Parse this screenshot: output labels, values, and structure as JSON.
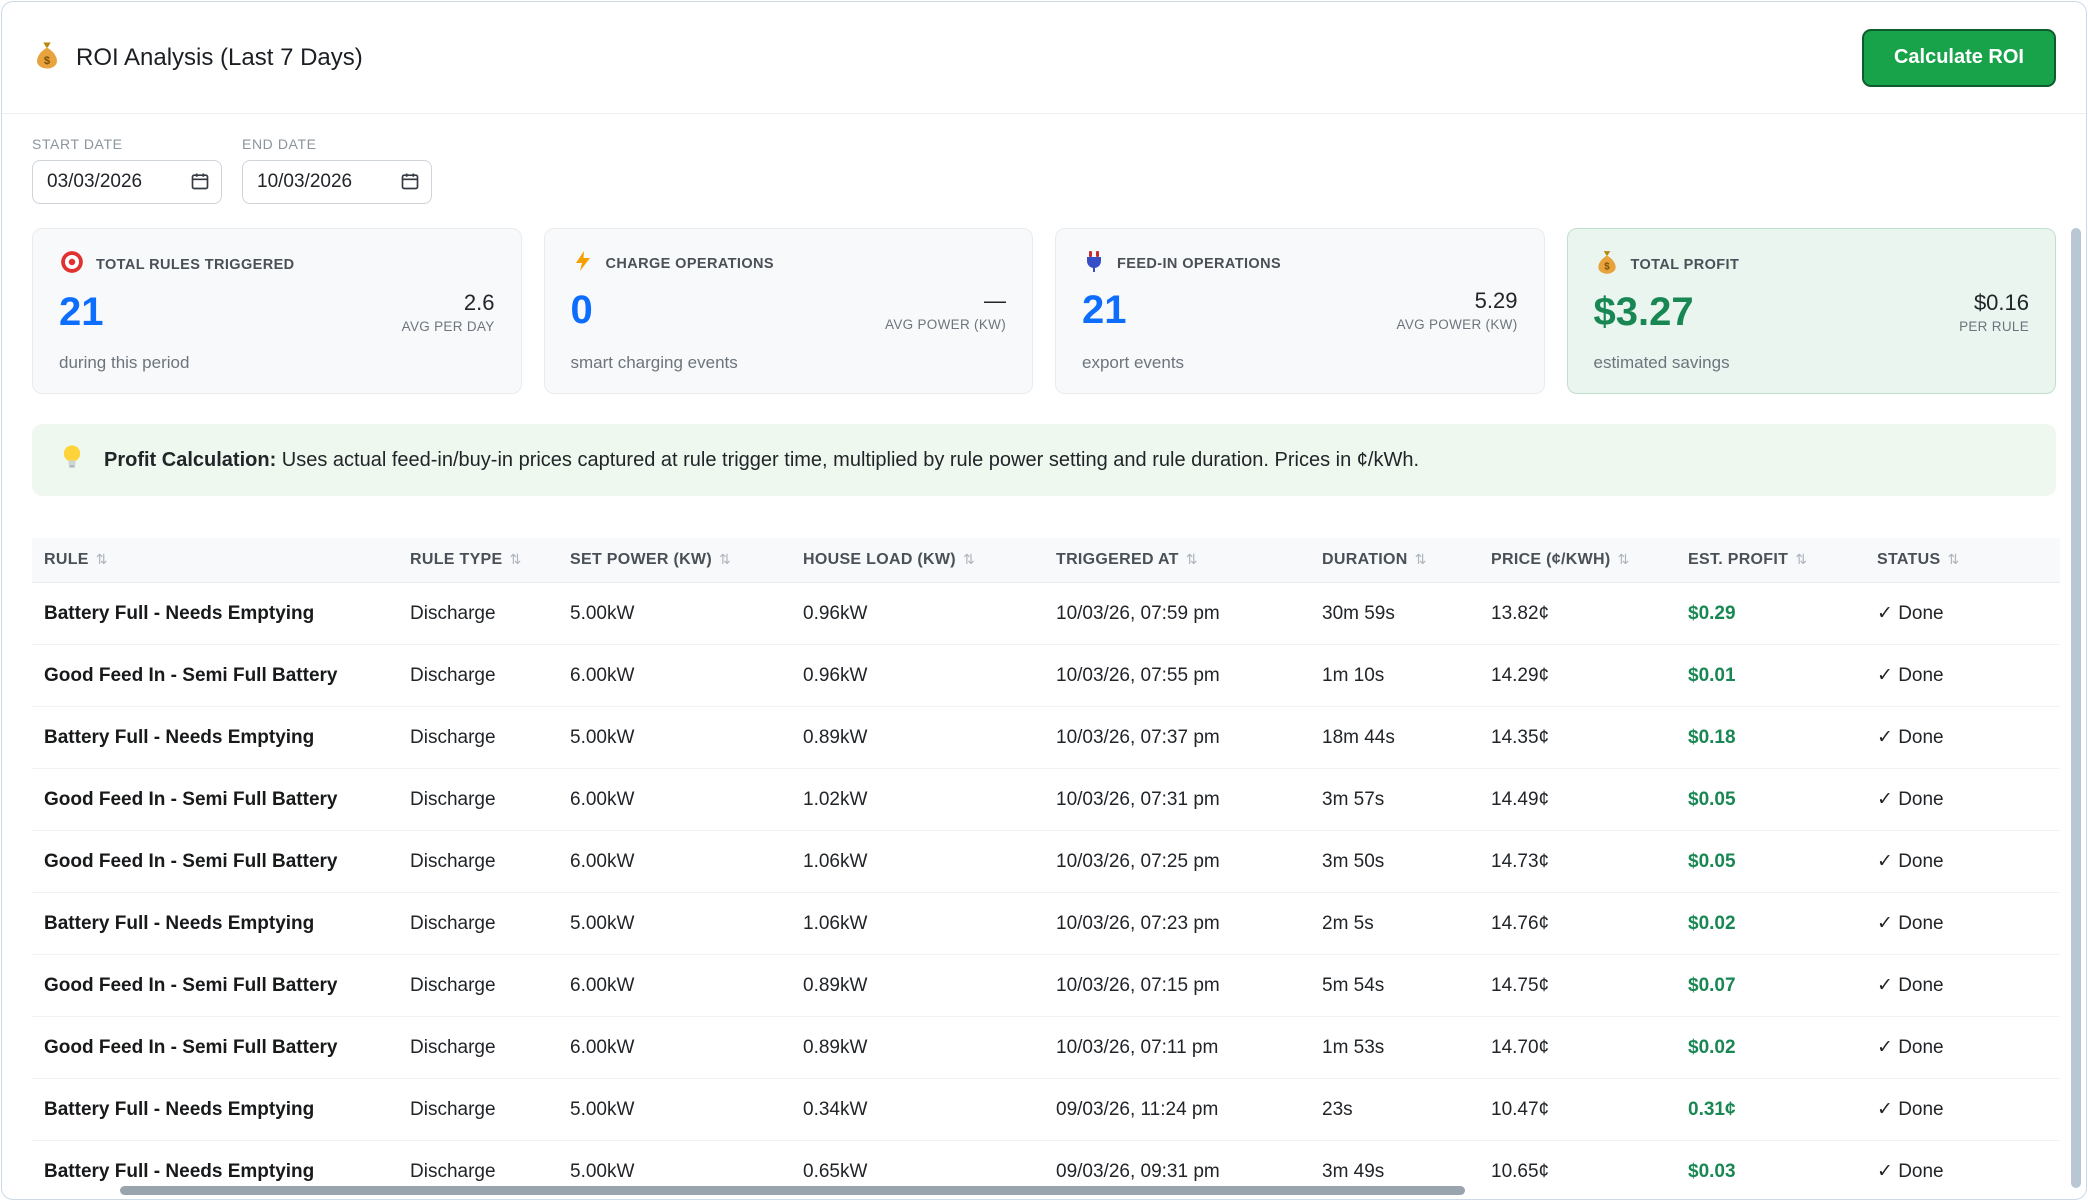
{
  "header": {
    "icon": "moneybag-icon",
    "title": "ROI Analysis (Last 7 Days)",
    "calculate_button_label": "Calculate ROI"
  },
  "filters": {
    "start_date_label": "START DATE",
    "start_date_value": "03/03/2026",
    "end_date_label": "END DATE",
    "end_date_value": "10/03/2026"
  },
  "stat_cards": [
    {
      "icon": "target-icon",
      "title": "TOTAL RULES TRIGGERED",
      "value": "21",
      "side_value": "2.6",
      "side_label": "AVG PER DAY",
      "footer": "during this period"
    },
    {
      "icon": "lightning-icon",
      "title": "CHARGE OPERATIONS",
      "value": "0",
      "side_value": "—",
      "side_label": "AVG POWER (KW)",
      "footer": "smart charging events"
    },
    {
      "icon": "plug-icon",
      "title": "FEED-IN OPERATIONS",
      "value": "21",
      "side_value": "5.29",
      "side_label": "AVG POWER (KW)",
      "footer": "export events"
    },
    {
      "icon": "moneybag-icon",
      "title": "TOTAL PROFIT",
      "value": "$3.27",
      "side_value": "$0.16",
      "side_label": "PER RULE",
      "footer": "estimated savings"
    }
  ],
  "info_banner": {
    "icon": "bulb-icon",
    "title": "Profit Calculation:",
    "text": "Uses actual feed-in/buy-in prices captured at rule trigger time, multiplied by rule power setting and rule duration. Prices in ¢/kWh."
  },
  "table": {
    "sort_glyph": "⇅",
    "columns": [
      {
        "key": "rule",
        "label": "RULE"
      },
      {
        "key": "rule_type",
        "label": "RULE TYPE"
      },
      {
        "key": "set_power",
        "label": "SET POWER (KW)"
      },
      {
        "key": "house_load",
        "label": "HOUSE LOAD (KW)"
      },
      {
        "key": "triggered_at",
        "label": "TRIGGERED AT"
      },
      {
        "key": "duration",
        "label": "DURATION"
      },
      {
        "key": "price",
        "label": "PRICE (¢/KWH)"
      },
      {
        "key": "est_profit",
        "label": "EST. PROFIT"
      },
      {
        "key": "status",
        "label": "STATUS"
      }
    ],
    "rows": [
      {
        "rule": "Battery Full - Needs Emptying",
        "rule_type": "Discharge",
        "set_power": "5.00kW",
        "house_load": "0.96kW",
        "triggered_at": "10/03/26, 07:59 pm",
        "duration": "30m 59s",
        "price": "13.82¢",
        "est_profit": "$0.29",
        "status": "✓ Done"
      },
      {
        "rule": "Good Feed In - Semi Full Battery",
        "rule_type": "Discharge",
        "set_power": "6.00kW",
        "house_load": "0.96kW",
        "triggered_at": "10/03/26, 07:55 pm",
        "duration": "1m 10s",
        "price": "14.29¢",
        "est_profit": "$0.01",
        "status": "✓ Done"
      },
      {
        "rule": "Battery Full - Needs Emptying",
        "rule_type": "Discharge",
        "set_power": "5.00kW",
        "house_load": "0.89kW",
        "triggered_at": "10/03/26, 07:37 pm",
        "duration": "18m 44s",
        "price": "14.35¢",
        "est_profit": "$0.18",
        "status": "✓ Done"
      },
      {
        "rule": "Good Feed In - Semi Full Battery",
        "rule_type": "Discharge",
        "set_power": "6.00kW",
        "house_load": "1.02kW",
        "triggered_at": "10/03/26, 07:31 pm",
        "duration": "3m 57s",
        "price": "14.49¢",
        "est_profit": "$0.05",
        "status": "✓ Done"
      },
      {
        "rule": "Good Feed In - Semi Full Battery",
        "rule_type": "Discharge",
        "set_power": "6.00kW",
        "house_load": "1.06kW",
        "triggered_at": "10/03/26, 07:25 pm",
        "duration": "3m 50s",
        "price": "14.73¢",
        "est_profit": "$0.05",
        "status": "✓ Done"
      },
      {
        "rule": "Battery Full - Needs Emptying",
        "rule_type": "Discharge",
        "set_power": "5.00kW",
        "house_load": "1.06kW",
        "triggered_at": "10/03/26, 07:23 pm",
        "duration": "2m 5s",
        "price": "14.76¢",
        "est_profit": "$0.02",
        "status": "✓ Done"
      },
      {
        "rule": "Good Feed In - Semi Full Battery",
        "rule_type": "Discharge",
        "set_power": "6.00kW",
        "house_load": "0.89kW",
        "triggered_at": "10/03/26, 07:15 pm",
        "duration": "5m 54s",
        "price": "14.75¢",
        "est_profit": "$0.07",
        "status": "✓ Done"
      },
      {
        "rule": "Good Feed In - Semi Full Battery",
        "rule_type": "Discharge",
        "set_power": "6.00kW",
        "house_load": "0.89kW",
        "triggered_at": "10/03/26, 07:11 pm",
        "duration": "1m 53s",
        "price": "14.70¢",
        "est_profit": "$0.02",
        "status": "✓ Done"
      },
      {
        "rule": "Battery Full - Needs Emptying",
        "rule_type": "Discharge",
        "set_power": "5.00kW",
        "house_load": "0.34kW",
        "triggered_at": "09/03/26, 11:24 pm",
        "duration": "23s",
        "price": "10.47¢",
        "est_profit": "0.31¢",
        "status": "✓ Done"
      },
      {
        "rule": "Battery Full - Needs Emptying",
        "rule_type": "Discharge",
        "set_power": "5.00kW",
        "house_load": "0.65kW",
        "triggered_at": "09/03/26, 09:31 pm",
        "duration": "3m 49s",
        "price": "10.65¢",
        "est_profit": "$0.03",
        "status": "✓ Done"
      }
    ]
  },
  "colors": {
    "accent_blue": "#0d6efd",
    "success_green": "#198754",
    "button_green": "#18a34a",
    "card_bg": "#f8f9fa",
    "profit_card_bg": "#e9f5ee",
    "banner_bg": "#eef8ef"
  }
}
